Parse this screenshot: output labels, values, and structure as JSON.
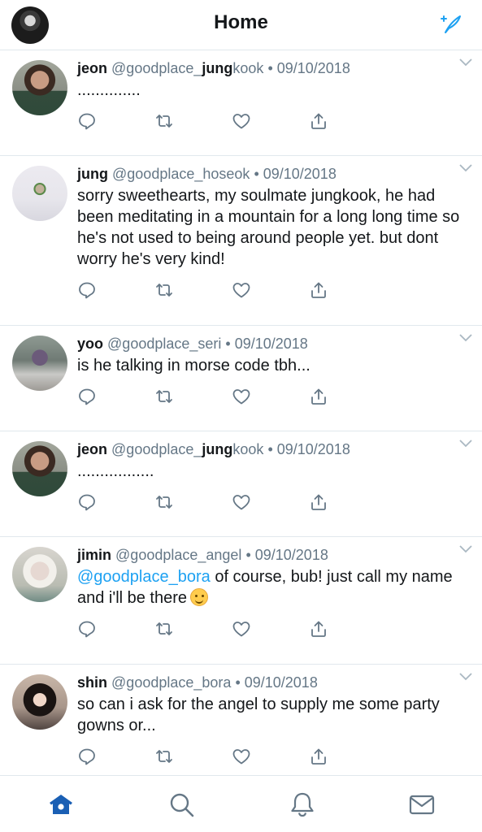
{
  "header": {
    "title": "Home",
    "profile_icon": "profile-avatar",
    "compose_icon": "compose-tweet-icon"
  },
  "tweets": [
    {
      "name": "jeon",
      "handle_pre": "@goodplace_",
      "handle_bold": "jung",
      "handle_post": "kook",
      "date": "• 09/10/2018",
      "text": "..............",
      "avatar": "av-jk"
    },
    {
      "name": "jung",
      "handle_pre": "@goodplace_hoseok",
      "handle_bold": "",
      "handle_post": "",
      "date": "• 09/10/2018",
      "text": "sorry sweethearts, my soulmate jungkook, he had been meditating in a mountain for a long long time so he's not used to being around people yet. but dont worry he's very kind!",
      "avatar": "av-hs"
    },
    {
      "name": "yoo",
      "handle_pre": "@goodplace_seri",
      "handle_bold": "",
      "handle_post": "",
      "date": "• 09/10/2018",
      "text": "is he talking in morse code tbh...",
      "avatar": "av-seri"
    },
    {
      "name": "jeon",
      "handle_pre": "@goodplace_",
      "handle_bold": "jung",
      "handle_post": "kook",
      "date": "• 09/10/2018",
      "text": ".................",
      "avatar": "av-jk"
    },
    {
      "name": "jimin",
      "handle_pre": "@goodplace_angel",
      "handle_bold": "",
      "handle_post": "",
      "date": "• 09/10/2018",
      "mention": "@goodplace_bora",
      "text": " of course, bub! just call my name and i'll be there",
      "emoji": "smiling-face-emoji",
      "avatar": "av-jimin"
    },
    {
      "name": "shin",
      "handle_pre": "@goodplace_bora",
      "handle_bold": "",
      "handle_post": "",
      "date": "• 09/10/2018",
      "text": "so can i ask for the angel to supply me some party gowns or...",
      "avatar": "av-bora"
    }
  ],
  "actions": [
    "reply-icon",
    "retweet-icon",
    "like-icon",
    "share-icon"
  ],
  "tabbar": [
    "home-icon",
    "search-icon",
    "notifications-icon",
    "messages-icon"
  ],
  "colors": {
    "accent": "#1da1f2",
    "tab_active": "#1a5fb4",
    "icon": "#657786",
    "text": "#14171a"
  }
}
